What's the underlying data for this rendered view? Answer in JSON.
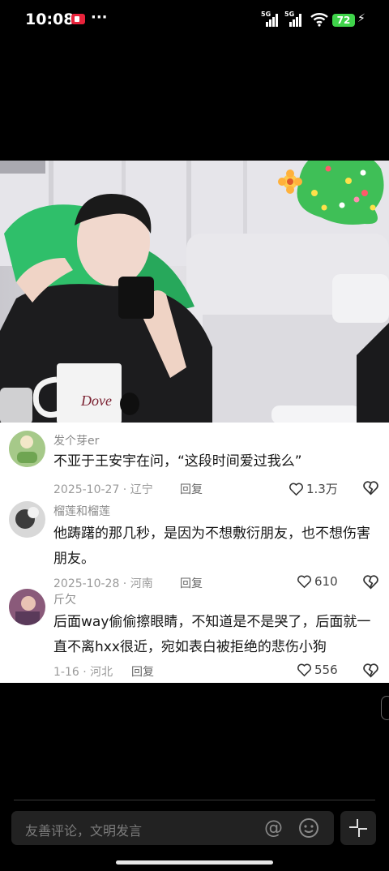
{
  "status": {
    "time": "10:08",
    "battery": "72",
    "net1": "5G",
    "net2": "5G"
  },
  "comments": [
    {
      "user": "发个芽er",
      "text": "不亚于王安宇在问，“这段时间爱过我么”",
      "meta": "2025-10-27 · 辽宁",
      "reply": "回复",
      "likes": "1.3万"
    },
    {
      "user": "榴莲和榴莲",
      "text": "他踌躇的那几秒，是因为不想敷衍朋友，也不想伤害朋友。",
      "meta": "2025-10-28 · 河南",
      "reply": "回复",
      "likes": "610"
    },
    {
      "user": "斤欠",
      "text": "后面way偷偷擦眼睛，不知道是不是哭了，后面就一直不离hxx很近，宛如表白被拒绝的悲伤小狗",
      "meta": "1-16 · 河北",
      "reply": "回复",
      "likes": "556"
    }
  ],
  "input": {
    "placeholder": "友善评论，文明发言"
  },
  "colors": {
    "battery": "#3fd34a",
    "record": "#e8233b",
    "sticker_tree": "#3fbf57"
  }
}
